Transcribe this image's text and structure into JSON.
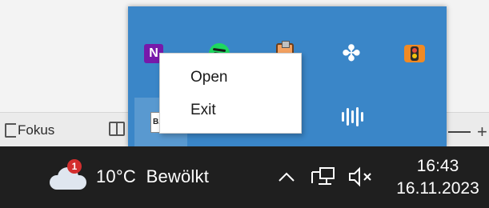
{
  "app": {
    "focus_label": "Fokus",
    "zoom_plus": "+"
  },
  "tray_overflow": {
    "icons": [
      {
        "name": "onenote-icon",
        "glyph": "N"
      },
      {
        "name": "spotify-icon"
      },
      {
        "name": "clipboard-app-icon"
      },
      {
        "name": "fan-icon",
        "glyph": "✤"
      },
      {
        "name": "traffic-light-icon"
      },
      {
        "name": "document-app-icon"
      },
      {
        "name": "audio-wave-icon"
      }
    ]
  },
  "context_menu": {
    "items": [
      {
        "label": "Open"
      },
      {
        "label": "Exit"
      }
    ]
  },
  "taskbar": {
    "weather": {
      "badge": "1",
      "temperature": "10°C",
      "condition": "Bewölkt",
      "text": "10°C  Bewölkt"
    },
    "clock": {
      "time": "16:43",
      "date": "16.11.2023"
    }
  },
  "colors": {
    "flyout_background": "#3a86c8",
    "taskbar_background": "#1f1f1f",
    "badge": "#d32f2f"
  }
}
